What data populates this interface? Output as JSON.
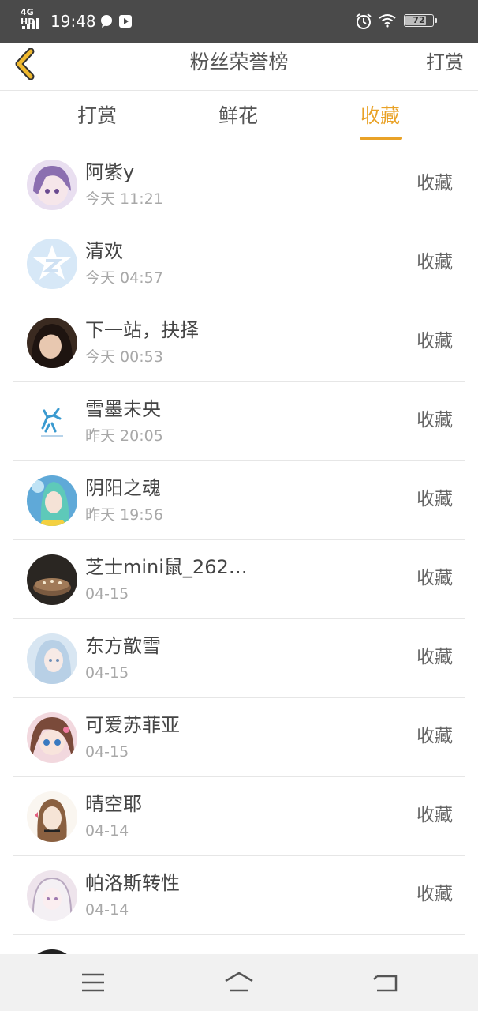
{
  "status_bar": {
    "network": "4G HD",
    "time": "19:48",
    "battery": "72",
    "icons": [
      "signal-icon",
      "message-icon",
      "video-icon",
      "alarm-icon",
      "wifi-icon",
      "battery-icon"
    ]
  },
  "header": {
    "title": "粉丝荣誉榜",
    "action": "打赏",
    "back_icon": "chevron-left-icon"
  },
  "tabs": [
    {
      "label": "打赏",
      "active": false
    },
    {
      "label": "鲜花",
      "active": false
    },
    {
      "label": "收藏",
      "active": true
    }
  ],
  "colors": {
    "accent": "#e9a227",
    "status_bar": "#4a4a4a",
    "divider": "#e6e6e6",
    "nav_bar": "#f1f1f1"
  },
  "fans": [
    {
      "name": "阿紫y",
      "time": "今天 11:21",
      "action": "收藏"
    },
    {
      "name": "清欢",
      "time": "今天 04:57",
      "action": "收藏"
    },
    {
      "name": "下一站，抉择",
      "time": "今天 00:53",
      "action": "收藏"
    },
    {
      "name": "雪墨未央",
      "time": "昨天 20:05",
      "action": "收藏"
    },
    {
      "name": "阴阳之魂",
      "time": "昨天 19:56",
      "action": "收藏"
    },
    {
      "name": "芝士mini鼠_262…",
      "time": "04-15",
      "action": "收藏"
    },
    {
      "name": "东方歆雪",
      "time": "04-15",
      "action": "收藏"
    },
    {
      "name": "可爱苏菲亚",
      "time": "04-15",
      "action": "收藏"
    },
    {
      "name": "晴空耶",
      "time": "04-14",
      "action": "收藏"
    },
    {
      "name": "帕洛斯转性",
      "time": "04-14",
      "action": "收藏"
    }
  ],
  "nav_bar": {
    "icons": [
      "menu-icon",
      "home-icon",
      "back-icon"
    ]
  }
}
